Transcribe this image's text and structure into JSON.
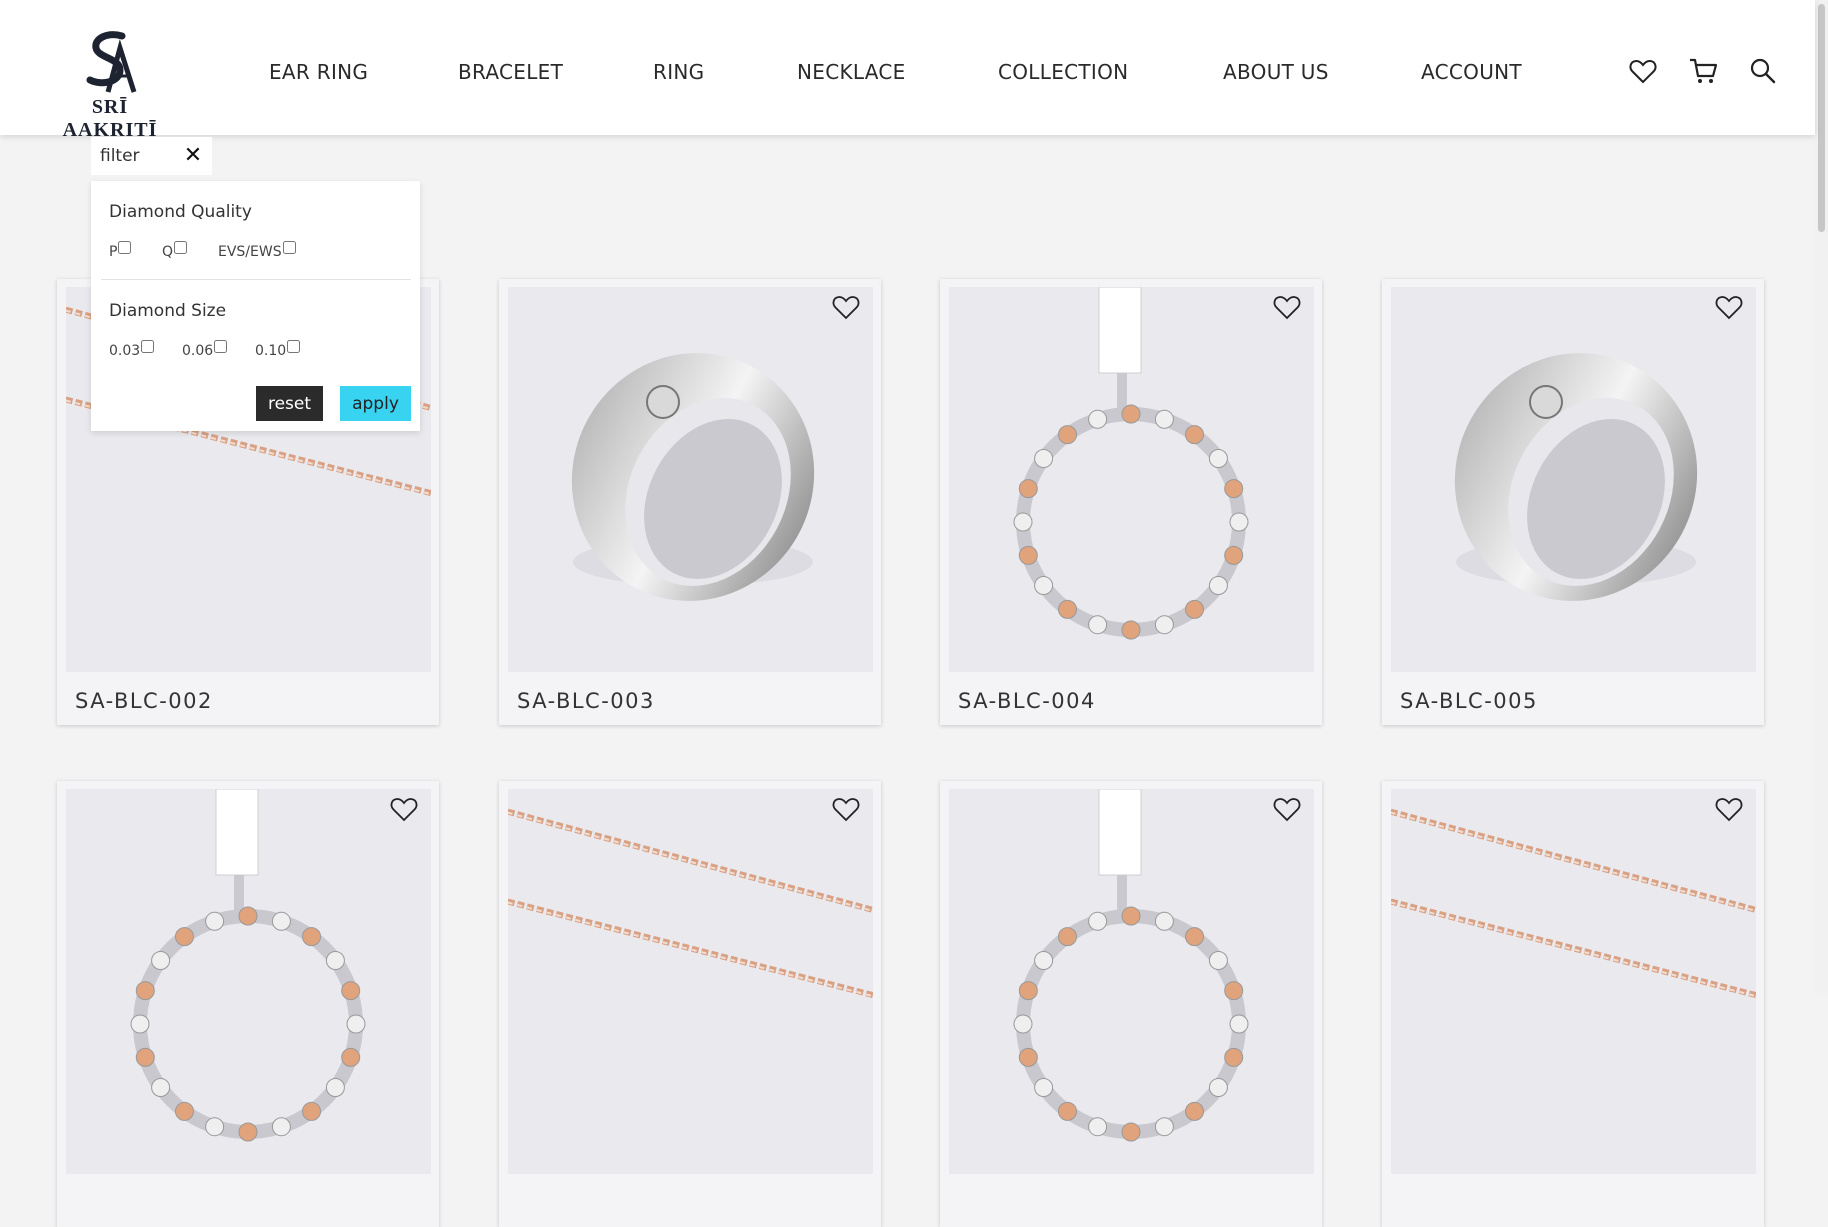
{
  "brand": {
    "name": "SRĪ AAKRITĪ",
    "logo_mark": "SA"
  },
  "nav": {
    "items": [
      {
        "label": "EAR RING"
      },
      {
        "label": "BRACELET"
      },
      {
        "label": "RING"
      },
      {
        "label": "NECKLACE"
      },
      {
        "label": "COLLECTION"
      },
      {
        "label": "ABOUT US"
      },
      {
        "label": "ACCOUNT"
      }
    ]
  },
  "header_icons": [
    "heart-icon",
    "cart-icon",
    "search-icon"
  ],
  "filter": {
    "tag_label": "filter",
    "close_icon": "close-icon",
    "quality": {
      "title": "Diamond Quality",
      "options": [
        {
          "label": "P",
          "checked": false
        },
        {
          "label": "Q",
          "checked": false
        },
        {
          "label": "EVS/EWS",
          "checked": false
        }
      ]
    },
    "size": {
      "title": "Diamond Size",
      "options": [
        {
          "label": "0.03",
          "checked": false
        },
        {
          "label": "0.06",
          "checked": false
        },
        {
          "label": "0.10",
          "checked": false
        }
      ]
    },
    "reset_label": "reset",
    "apply_label": "apply"
  },
  "products": [
    {
      "title": "SA-BLC-002",
      "image": "chain"
    },
    {
      "title": "SA-BLC-003",
      "image": "ring"
    },
    {
      "title": "SA-BLC-004",
      "image": "bracelet"
    },
    {
      "title": "SA-BLC-005",
      "image": "ring"
    },
    {
      "title": "",
      "image": "bracelet"
    },
    {
      "title": "",
      "image": "chain"
    },
    {
      "title": "",
      "image": "bracelet"
    },
    {
      "title": "",
      "image": "chain"
    }
  ],
  "colors": {
    "apply_button": "#37d3f0",
    "reset_button": "#2b2b2b",
    "page_background": "#f3f3f4"
  }
}
